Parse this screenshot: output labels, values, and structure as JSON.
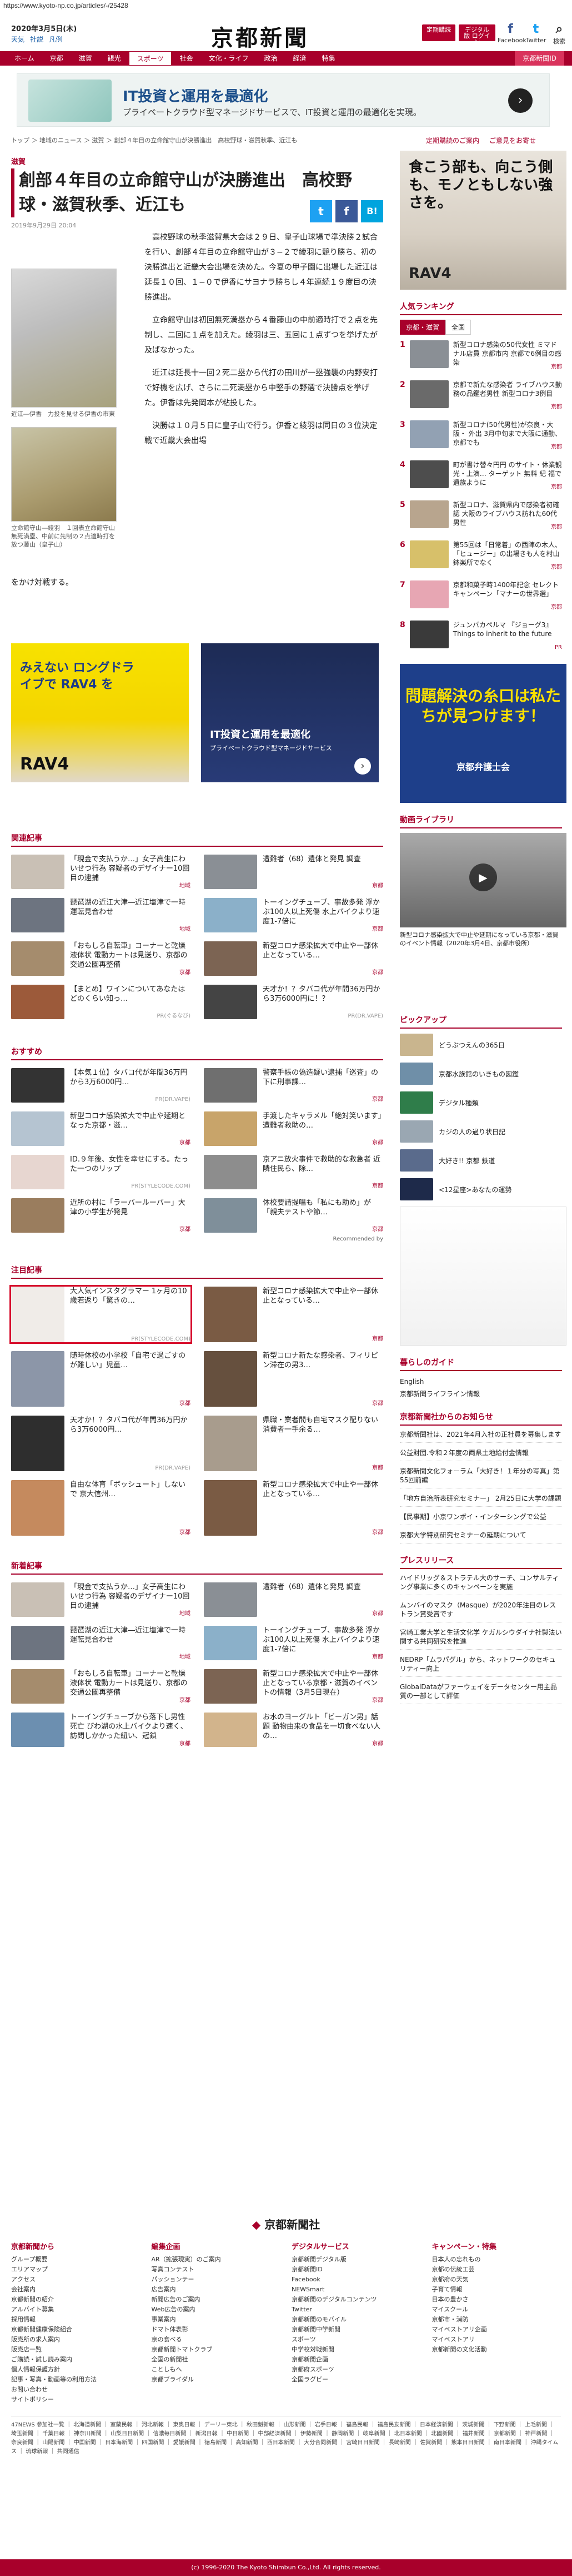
{
  "url": "https://www.kyoto-np.co.jp/articles/-/25428",
  "header": {
    "date": "2020年3月5日(木)",
    "links": [
      "天気",
      "社説",
      "凡例"
    ],
    "logo": "京都新聞",
    "btn_digital": "定期購読",
    "btn_member": "デジタル版 ログイン",
    "social": [
      {
        "icon": "facebook-icon",
        "glyph": "f",
        "label": "Facebook"
      },
      {
        "icon": "twitter-icon",
        "glyph": "t",
        "label": "Twitter"
      },
      {
        "icon": "search-icon",
        "glyph": "⌕",
        "label": "検索"
      }
    ]
  },
  "nav": [
    "ホーム",
    "京都",
    "滋賀",
    "観光",
    "スポーツ",
    "社会",
    "文化・ライフ",
    "政治",
    "経済",
    "特集",
    "京都新聞ID"
  ],
  "top_ad": {
    "title": "IT投資と運用を最適化",
    "sub": "プライベートクラウド型マネージドサービスで、IT投資と運用の最適化を実現。"
  },
  "breadcrumb": "トップ ＞ 地域のニュース ＞ 滋賀 ＞ 創部４年目の立命館守山が決勝進出　高校野球・滋賀秋季、近江も",
  "article": {
    "category": "滋賀",
    "title": "創部４年目の立命館守山が決勝進出　高校野球・滋賀秋季、近江も",
    "date": "2019年9月29日 20:04",
    "photo1_caption": "近江―伊香　力投を見せる伊香の市東",
    "photo2_caption": "立命館守山―綾羽　１回表立命館守山無死満塁、中前に先制の２点適時打を放つ藤山（皇子山）",
    "paragraphs": [
      "高校野球の秋季滋賀県大会は２９日、皇子山球場で準決勝２試合を行い、創部４年目の立命館守山が３−２で綾羽に競り勝ち、初の決勝進出と近畿大会出場を決めた。今夏の甲子園に出場した近江は延長１０回、１−０で伊香にサヨナラ勝ちし４年連続１９度目の決勝進出。",
      "立命館守山は初回無死満塁から４番藤山の中前適時打で２点を先制し、二回に１点を加えた。綾羽は三、五回に１点ずつを挙げたが及ばなかった。",
      "近江は延長十一回２死二塁から代打の田川が一塁強襲の内野安打で好機を広げ、さらに二死満塁から中堅手の野選で決勝点を挙げた。伊香は先発岡本が粘投した。",
      "決勝は１０月５日に皇子山で行う。伊香と綾羽は同日の３位決定戦で近畿大会出場"
    ],
    "tail": "をかけ対戦する。"
  },
  "ads_mid": {
    "toyota": "みえない ロングドライブで RAV4 を",
    "toyota_brand": "RAV4",
    "biz_title": "IT投資と運用を最適化",
    "biz_sub": "プライベートクラウド型マネージドサービス"
  },
  "related": {
    "heading": "関連記事",
    "items": [
      {
        "text": "「現金で支払うか…」女子高生にわいせつ行為 容疑者のデザイナー10回目の逮捕",
        "tag": "地域"
      },
      {
        "text": "遭難者（68）遺体と発見 調査",
        "tag": "京都"
      },
      {
        "text": "琵琶湖の近江大津―近江塩津で一時運転見合わせ",
        "tag": "地域"
      },
      {
        "text": "トーイングチューブ、事故多発 浮かぶ100人以上死傷 水上バイクより速度1-7倍に",
        "tag": "京都"
      },
      {
        "text": "「おもしろ自転車」コーナーと乾燥液体状 電動カートは見送り、京都の交通公園再整備",
        "tag": "京都"
      },
      {
        "text": "新型コロナ感染拡大で中止や一部休止となっている…",
        "tag": "京都"
      },
      {
        "text": "【まとめ】ワインについてあなたはどのくらい知っ…",
        "tag": "PR(ぐるなび)"
      },
      {
        "text": "天才か！？タバコ代が年間36万円から3万6000円に！？",
        "tag": "PR(DR.VAPE)"
      }
    ]
  },
  "recommend": {
    "heading": "おすすめ",
    "items": [
      {
        "text": "【本気１位】タバコ代が年間36万円から3万6000円…",
        "tag": "PR(DR.VAPE)"
      },
      {
        "text": "警察手帳の偽造疑い逮捕「巡査」の下に刑事課…",
        "tag": "京都"
      },
      {
        "text": "新型コロナ感染拡大で中止や延期となった京都・滋…",
        "tag": "京都"
      },
      {
        "text": "手渡したキャラメル「絶対笑います」遭難者救助の…",
        "tag": "京都"
      },
      {
        "text": "ID.９年後、女性を幸せにする。たった一つのリップ",
        "tag": "PR(STYLECODE.COM)"
      },
      {
        "text": "京アニ放火事件で救助的な救急者 近隣住民ら、除…",
        "tag": "京都"
      },
      {
        "text": "近所の村に「ラーバールーバー」大津の小学生が発見",
        "tag": "京都"
      },
      {
        "text": "休校要請提唱も「私にも助め」が「親夫テストや節…",
        "tag": "京都"
      }
    ],
    "recommended_by": "Recommended by"
  },
  "notable": {
    "heading": "注目記事",
    "items": [
      {
        "text": "大人気インスタグラマー 1ヶ月の10歳若返り「驚きの…",
        "tag": "PR(STYLECODE.COM)"
      },
      {
        "text": "新型コロナ感染拡大で中止や一部休止となっている…",
        "tag": "京都"
      },
      {
        "text": "随時休校の小学校「自宅で過ごすのが難しい」児童…",
        "tag": "京都"
      },
      {
        "text": "新型コロナ新たな感染者、フィリピン滞在の男3…",
        "tag": "京都"
      },
      {
        "text": "天才か！？タバコ代が年間36万円から3万6000円…",
        "tag": "PR(DR.VAPE)"
      },
      {
        "text": "県職・業者間も自宅マスク配りない 消費者一手余る…",
        "tag": "京都"
      },
      {
        "text": "自由な体育「ボッシュート」しないで 京大信州…",
        "tag": "京都"
      },
      {
        "text": "新型コロナ感染拡大で中止や一部休止となっている…",
        "tag": "京都"
      }
    ]
  },
  "latest": {
    "heading": "新着記事",
    "items": [
      {
        "text": "「現金で支払うか…」女子高生にわいせつ行為 容疑者のデザイナー10回目の逮捕",
        "tag": "地域"
      },
      {
        "text": "遭難者（68）遺体と発見 調査",
        "tag": "京都"
      },
      {
        "text": "琵琶湖の近江大津―近江塩津で一時運転見合わせ",
        "tag": "地域"
      },
      {
        "text": "トーイングチューブ、事故多発 浮かぶ100人以上死傷 水上バイクより速度1-7倍に",
        "tag": "京都"
      },
      {
        "text": "「おもしろ自転車」コーナーと乾燥液体状 電動カートは見送り、京都の交通公園再整備",
        "tag": "京都"
      },
      {
        "text": "新型コロナ感染拡大で中止や一部休止となっている京都・滋賀のイベントの情報（3月5日現在）",
        "tag": "京都"
      },
      {
        "text": "トーイングチューブから落下し男性死亡 びわ湖の水上バイクより速く、訪問しかかった紐い、冠鎖",
        "tag": "京都"
      },
      {
        "text": "お水のヨーグルト「ビーガン男」話題 動物由来の食品を一切食べない人の…",
        "tag": "京都"
      }
    ]
  },
  "side": {
    "links": [
      "定期購読のご案内",
      "ご意見をお寄せ"
    ],
    "ad1_title": "食こう部も、向こう側も、モノともしない強さを。",
    "ad1_brand": "RAV4",
    "ranking_heading": "人気ランキング",
    "ranking_tabs": [
      "京都・滋賀",
      "全国"
    ],
    "ranking": [
      {
        "num": "1",
        "text": "新型コロナ感染の50代女性 ミマドナル店員 京都市内 京都で6例目の感染",
        "tag": "京都"
      },
      {
        "text": "京都で新たな感染者 ライブハウス勤務の品鑑者男性 新型コロナ3例目",
        "num": "2",
        "tag": "京都"
      },
      {
        "num": "3",
        "text": "新型コロナ(50代男性)が奈良・大阪・ 外出 3月中旬まで大阪に通勤、京都でも",
        "tag": "京都"
      },
      {
        "num": "4",
        "text": "町が書け替々円円 のサイト・休業観光・上演… ターゲット 無料 紀 福で 遺族ように",
        "tag": "京都"
      },
      {
        "num": "5",
        "text": "新型コロナ、滋賀県内で感染者初確認 大阪のライブハウス訪れた60代男性",
        "tag": "京都"
      },
      {
        "num": "6",
        "text": "第55回は「日常着」の西陣の木人、「ヒュージー」の出場きも人を村山鉢楽所でなく",
        "tag": "京都"
      },
      {
        "num": "7",
        "text": "京都和菓子時1400年記念 セレクトキャンペーン「マナーの世界選」",
        "tag": "京都"
      },
      {
        "num": "8",
        "text": "ジュンパカペルマ 『ジョーグ3』 Things to inherit to the future",
        "tag": "PR"
      }
    ],
    "ad2_title": "問題解決の糸口は私たちが見つけます！",
    "ad2_brand": "京都弁護士会",
    "video_heading": "動画ライブラリ",
    "video_caption": "新型コロナ感染拡大で中止や延期になっている京都・滋賀のイベント情報（2020年3月4日、京都市役所）",
    "pickup_heading": "ピックアップ",
    "pickup": [
      {
        "text": "どうぶつえんの365日"
      },
      {
        "text": "京都水族館のいきもの図鑑"
      },
      {
        "text": "デジタル種類"
      },
      {
        "text": "カジの人の過り状日記"
      },
      {
        "text": "大好き!! 京都 鉄道"
      },
      {
        "text": "<12星座>あなたの運勢"
      }
    ],
    "guide_heading": "暮らしのガイド",
    "guide": [
      "English",
      "京都新聞ライフライン情報"
    ],
    "notice_heading": "京都新聞社からのお知らせ",
    "notices": [
      "京都新聞社は、2021年4月入社の正社員を募集します",
      "公益財団.令和２年度の両県土地給付金情報",
      "京都新聞文化フォーラム「大好き！１年分の写真」第55回前編",
      "「地方自治所表研究セミナー」 2月25日に大学の課題",
      "【民事期】小京ワンボイ・インターシングで公益",
      "京都大学特別研究セミナーの延期について"
    ],
    "press_heading": "プレスリリース",
    "press": [
      "ハイドリッグ＆ストラテル大のサーチ、コンサルティング事業に多くのキャンペーンを実施",
      "ムンバイのマスク（Masque）が2020年注目のレストラン賞受賞です",
      "宮崎工業大学と生活文化学 ケガルシウダイナ社製法い関する共同研究を推進",
      "NEDRP「ムラパグル」から、ネットワークのセキュリティー向上",
      "GlobalDataがファーウェイをデータセンター用主品質の一部として評価"
    ]
  },
  "footer": {
    "logo": "京都新聞社",
    "cols": [
      {
        "h": "京都新聞から",
        "items": [
          "グループ概要",
          "エリアマップ",
          "アクセス",
          "会社案内",
          "京都新聞の紹介",
          "アルバイト募集",
          "採用情報",
          "京都新聞健康保険組合",
          "販売所の求人案内",
          "販売店一覧",
          "ご購読・試し読み案内",
          "個人情報保護方針",
          "記事・写真・動画等の利用方法",
          "お問い合わせ",
          "サイトポリシー"
        ]
      },
      {
        "h": "編集企画",
        "items": [
          "AR（拡張現実）のご案内",
          "写真コンテスト",
          "パッションテー",
          "広告案内",
          "新聞広告のご案内",
          "Web広告の案内",
          "事業案内",
          "ドマト体表彰",
          "京の食べる",
          "京都新聞トマトクラブ",
          "全国の新聞社",
          "ことしもへ",
          "京都ブライダル"
        ]
      },
      {
        "h": "デジタルサービス",
        "items": [
          "京都新聞デジタル版",
          "京都新聞ID",
          "Facebook",
          "NEWSmart",
          "京都新聞のデジタルコンテンツ",
          "Twitter",
          "京都新聞のモバイル",
          "京都新聞中学新聞",
          "スポーツ",
          "中学校対戦新聞",
          "京都新聞企画",
          "京都府スポーツ",
          "全国ラグビー"
        ]
      },
      {
        "h": "キャンペーン・特集",
        "items": [
          "日本人の忘れもの",
          "京都の伝統工芸",
          "京都府の天気",
          "子育て情報",
          "日本の豊かさ",
          "マイスクール",
          "京都市・消防",
          "マイベストアリ企画",
          "マイベストアリ",
          "京都新聞の文化活動"
        ]
      }
    ],
    "fournews": "47NEWS 参加社一覧 ｜ 北海道新聞 ｜ 室蘭民報 ｜ 河北新報 ｜ 東奥日報 ｜ デーリー東北 ｜ 秋田魁新報 ｜ 山形新聞 ｜ 岩手日報 ｜ 福島民報 ｜ 福島民友新聞 ｜ 日本経済新聞 ｜ 茨城新聞 ｜ 下野新聞 ｜ 上毛新聞 ｜ 埼玉新聞 ｜ 千葉日報 ｜ 神奈川新聞 ｜ 山梨日日新聞 ｜ 信濃毎日新聞 ｜ 新潟日報 ｜ 中日新聞 ｜ 中部経済新聞 ｜ 伊勢新聞 ｜ 静岡新聞 ｜ 岐阜新聞 ｜ 北日本新聞 ｜ 北國新聞 ｜ 福井新聞 ｜ 京都新聞 ｜ 神戸新聞 ｜ 奈良新聞 ｜ 山陽新聞 ｜ 中国新聞 ｜ 日本海新聞 ｜ 四国新聞 ｜ 愛媛新聞 ｜ 徳島新聞 ｜ 高知新聞 ｜ 西日本新聞 ｜ 大分合同新聞 ｜ 宮崎日日新聞 ｜ 長崎新聞 ｜ 佐賀新聞 ｜ 熊本日日新聞 ｜ 南日本新聞 ｜ 沖縄タイムス ｜ 琉球新報 ｜ 共同通信",
    "copyright": "(c) 1996-2020 The Kyoto Shimbun Co.,Ltd. All rights reserved."
  },
  "colors": {
    "brand": "#a8002b",
    "facebook": "#3b5998",
    "twitter": "#1da1f2",
    "hatena": "#00a4de"
  }
}
